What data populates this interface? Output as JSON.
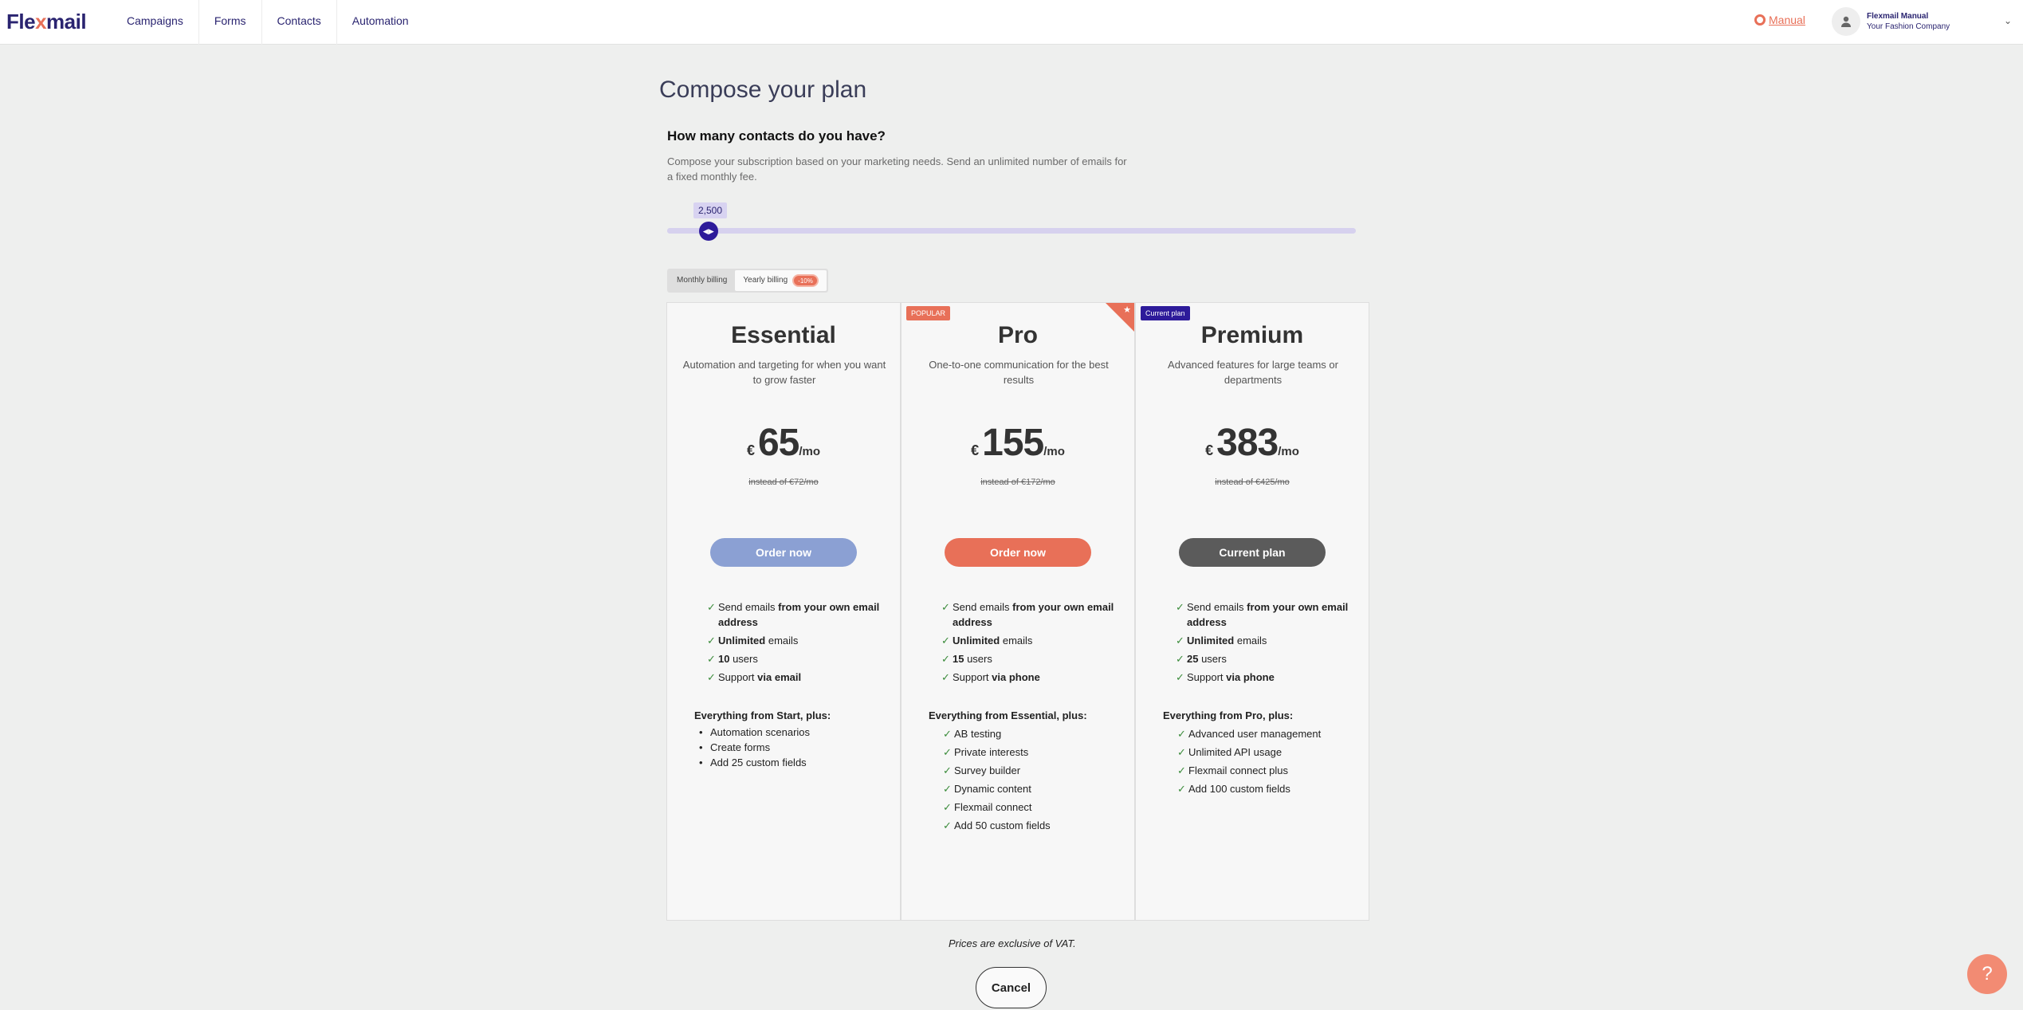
{
  "app": {
    "logo_prefix": "Fle",
    "logo_x": "x",
    "logo_suffix": "mail"
  },
  "nav": {
    "items": [
      "Campaigns",
      "Forms",
      "Contacts",
      "Automation"
    ]
  },
  "header": {
    "manual_label": "Manual",
    "user_name": "Flexmail Manual",
    "user_company": "Your Fashion Company"
  },
  "page": {
    "title": "Compose your plan",
    "question": "How many contacts do you have?",
    "description": "Compose your subscription based on your marketing needs. Send an unlimited number of emails for a fixed monthly fee."
  },
  "slider": {
    "value_label": "2,500",
    "level_fraction": 0.06
  },
  "billing": {
    "monthly_label": "Monthly billing",
    "yearly_label": "Yearly billing",
    "yearly_discount": "-10%",
    "selected": "yearly"
  },
  "plans": [
    {
      "name": "Essential",
      "tagline": "Automation and targeting for when you want to grow faster",
      "currency": "€",
      "price": "65",
      "per": "/mo",
      "old_price": "instead of  €72/mo",
      "button": "Order now",
      "features": [
        {
          "pre": "Send emails ",
          "bold": "from your own email address",
          "post": ""
        },
        {
          "pre": "",
          "bold": "Unlimited",
          "post": " emails"
        },
        {
          "pre": "",
          "bold": "10",
          "post": " users"
        },
        {
          "pre": "Support ",
          "bold": "via email",
          "post": ""
        }
      ],
      "extras_title": "Everything from Start, plus:",
      "extras": [
        "Automation scenarios",
        "Create forms",
        "Add 25 custom fields"
      ]
    },
    {
      "name": "Pro",
      "badge": "POPULAR",
      "tagline": "One-to-one communication for the best results",
      "currency": "€",
      "price": "155",
      "per": "/mo",
      "old_price": "instead of  €172/mo",
      "button": "Order now",
      "features": [
        {
          "pre": "Send emails ",
          "bold": "from your own email address",
          "post": ""
        },
        {
          "pre": "",
          "bold": "Unlimited",
          "post": " emails"
        },
        {
          "pre": "",
          "bold": "15",
          "post": " users"
        },
        {
          "pre": "Support ",
          "bold": "via phone",
          "post": ""
        }
      ],
      "extras_title": "Everything from Essential, plus:",
      "extras": [
        "AB testing",
        "Private interests",
        "Survey builder",
        "Dynamic content",
        "Flexmail connect",
        "Add 50 custom fields"
      ]
    },
    {
      "name": "Premium",
      "badge": "Current plan",
      "tagline": "Advanced features for large teams or departments",
      "currency": "€",
      "price": "383",
      "per": "/mo",
      "old_price": "instead of  €425/mo",
      "button": "Current plan",
      "features": [
        {
          "pre": "Send emails ",
          "bold": "from your own email address",
          "post": ""
        },
        {
          "pre": "",
          "bold": "Unlimited",
          "post": " emails"
        },
        {
          "pre": "",
          "bold": "25",
          "post": " users"
        },
        {
          "pre": "Support ",
          "bold": "via phone",
          "post": ""
        }
      ],
      "extras_title": "Everything from Pro, plus:",
      "extras": [
        "Advanced user management",
        "Unlimited API usage",
        "Flexmail connect plus",
        "Add 100 custom fields"
      ]
    }
  ],
  "footer": {
    "vat_note": "Prices are exclusive of VAT.",
    "cancel_label": "Cancel",
    "help_label": "?"
  },
  "colors": {
    "brand": "#2a2470",
    "accent": "#e87058",
    "essential_button": "#8ba0d3",
    "current_button": "#5b5b5b",
    "slider_handle": "#2d1b9a"
  }
}
